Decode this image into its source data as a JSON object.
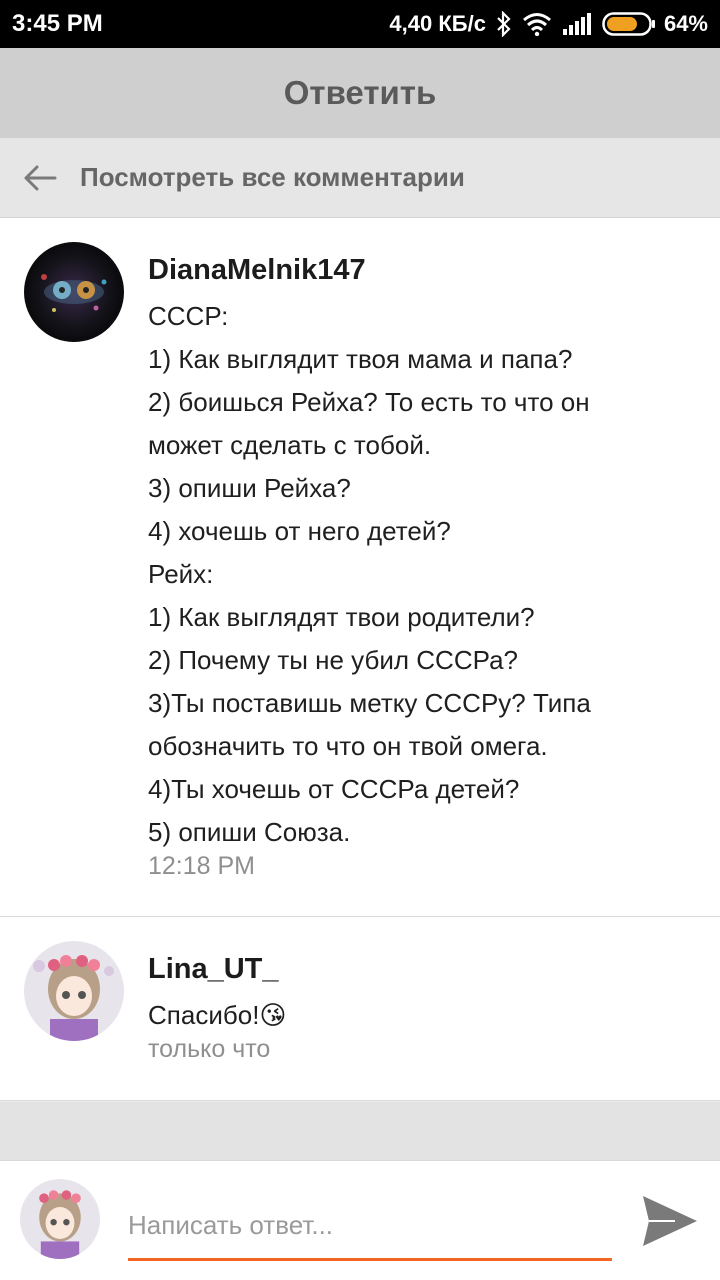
{
  "status_bar": {
    "time": "3:45 PM",
    "speed": "4,40 КБ/с",
    "battery": "64%"
  },
  "header": {
    "title": "Ответить"
  },
  "view_all": {
    "label": "Посмотреть все комментарии"
  },
  "comments": [
    {
      "username": "DianaMelnik147",
      "lines": [
        "СССР:",
        "1) Как выглядит твоя мама и папа?",
        "2) боишься Рейха? То есть то что он",
        "может сделать с тобой.",
        "3) опиши Рейха?",
        "4) хочешь от него детей?",
        "Рейх:",
        "1) Как выглядят твои родители?",
        "2) Почему ты не убил СССРа?",
        "3)Ты поставишь метку СССРу? Типа",
        "обозначить то что он твой омега.",
        "4)Ты хочешь от СССРа детей?",
        "5) опиши Союза."
      ],
      "time": "12:18 PM"
    },
    {
      "username": "Lina_UT_",
      "text": "Спасибо!",
      "emoji": "😘",
      "time": "только что"
    }
  ],
  "reply": {
    "placeholder": "Написать ответ..."
  },
  "colors": {
    "accent": "#f26522",
    "header_bg": "#cfcfcf",
    "send_icon": "#7a7a7a"
  },
  "icons": {
    "back": "arrow-left-icon",
    "send": "send-icon",
    "bluetooth": "bluetooth-icon",
    "wifi": "wifi-icon",
    "signal": "signal-icon",
    "battery": "battery-icon"
  }
}
